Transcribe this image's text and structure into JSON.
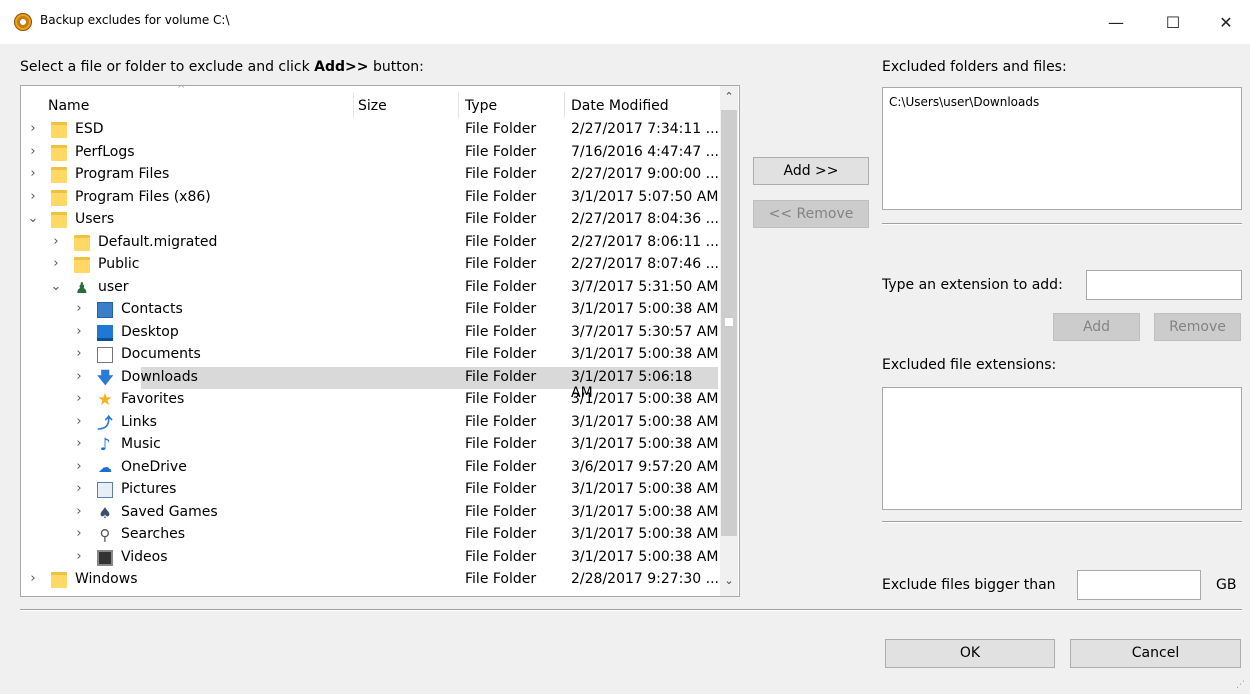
{
  "window": {
    "title": "Backup excludes for volume C:\\",
    "min_glyph": "—",
    "max_glyph": "☐",
    "close_glyph": "✕"
  },
  "labels": {
    "instruction_prefix": "Select a file or folder to exclude and click ",
    "instruction_bold": "Add>>",
    "instruction_suffix": " button:",
    "excluded_folders": "Excluded folders and files:",
    "type_extension": "Type an extension to add:",
    "excluded_extensions": "Excluded file extensions:",
    "exclude_bigger": "Exclude files bigger than",
    "gb_unit": "GB"
  },
  "tree": {
    "columns": [
      "Name",
      "Size",
      "Type",
      "Date Modified"
    ],
    "rows": [
      {
        "name": "ESD",
        "type": "File Folder",
        "date": "2/27/2017 7:34:11 ...",
        "icon": "folder-icon",
        "level": 0,
        "expanded": false
      },
      {
        "name": "PerfLogs",
        "type": "File Folder",
        "date": "7/16/2016 4:47:47 ...",
        "icon": "folder-icon",
        "level": 0,
        "expanded": false
      },
      {
        "name": "Program Files",
        "type": "File Folder",
        "date": "2/27/2017 9:00:00 ...",
        "icon": "folder-icon",
        "level": 0,
        "expanded": false
      },
      {
        "name": "Program Files (x86)",
        "type": "File Folder",
        "date": "3/1/2017 5:07:50 AM",
        "icon": "folder-icon",
        "level": 0,
        "expanded": false
      },
      {
        "name": "Users",
        "type": "File Folder",
        "date": "2/27/2017 8:04:36 ...",
        "icon": "folder-icon",
        "level": 0,
        "expanded": true
      },
      {
        "name": "Default.migrated",
        "type": "File Folder",
        "date": "2/27/2017 8:06:11 ...",
        "icon": "folder-icon",
        "level": 1,
        "expanded": false
      },
      {
        "name": "Public",
        "type": "File Folder",
        "date": "2/27/2017 8:07:46 ...",
        "icon": "folder-icon",
        "level": 1,
        "expanded": false
      },
      {
        "name": "user",
        "type": "File Folder",
        "date": "3/7/2017 5:31:50 AM",
        "icon": "user-icon",
        "level": 1,
        "expanded": true
      },
      {
        "name": "Contacts",
        "type": "File Folder",
        "date": "3/1/2017 5:00:38 AM",
        "icon": "contacts-icon",
        "level": 2,
        "expanded": false
      },
      {
        "name": "Desktop",
        "type": "File Folder",
        "date": "3/7/2017 5:30:57 AM",
        "icon": "desktop-icon",
        "level": 2,
        "expanded": false
      },
      {
        "name": "Documents",
        "type": "File Folder",
        "date": "3/1/2017 5:00:38 AM",
        "icon": "documents-icon",
        "level": 2,
        "expanded": false
      },
      {
        "name": "Downloads",
        "type": "File Folder",
        "date": "3/1/2017 5:06:18 AM",
        "icon": "downloads-icon",
        "level": 2,
        "expanded": false,
        "selected": true
      },
      {
        "name": "Favorites",
        "type": "File Folder",
        "date": "3/1/2017 5:00:38 AM",
        "icon": "favorites-icon",
        "level": 2,
        "expanded": false
      },
      {
        "name": "Links",
        "type": "File Folder",
        "date": "3/1/2017 5:00:38 AM",
        "icon": "links-icon",
        "level": 2,
        "expanded": false
      },
      {
        "name": "Music",
        "type": "File Folder",
        "date": "3/1/2017 5:00:38 AM",
        "icon": "music-icon",
        "level": 2,
        "expanded": false
      },
      {
        "name": "OneDrive",
        "type": "File Folder",
        "date": "3/6/2017 9:57:20 AM",
        "icon": "onedrive-icon",
        "level": 2,
        "expanded": false
      },
      {
        "name": "Pictures",
        "type": "File Folder",
        "date": "3/1/2017 5:00:38 AM",
        "icon": "pictures-icon",
        "level": 2,
        "expanded": false
      },
      {
        "name": "Saved Games",
        "type": "File Folder",
        "date": "3/1/2017 5:00:38 AM",
        "icon": "saved-games-icon",
        "level": 2,
        "expanded": false
      },
      {
        "name": "Searches",
        "type": "File Folder",
        "date": "3/1/2017 5:00:38 AM",
        "icon": "searches-icon",
        "level": 2,
        "expanded": false
      },
      {
        "name": "Videos",
        "type": "File Folder",
        "date": "3/1/2017 5:00:38 AM",
        "icon": "videos-icon",
        "level": 2,
        "expanded": false
      },
      {
        "name": "Windows",
        "type": "File Folder",
        "date": "2/28/2017 9:27:30 ...",
        "icon": "folder-icon",
        "level": 0,
        "expanded": false
      }
    ]
  },
  "buttons": {
    "add": "Add >>",
    "remove": "<< Remove",
    "ext_add": "Add",
    "ext_remove": "Remove",
    "ok": "OK",
    "cancel": "Cancel"
  },
  "excluded": {
    "items": [
      "C:\\Users\\user\\Downloads"
    ]
  },
  "inputs": {
    "extension_value": "",
    "size_value": ""
  }
}
